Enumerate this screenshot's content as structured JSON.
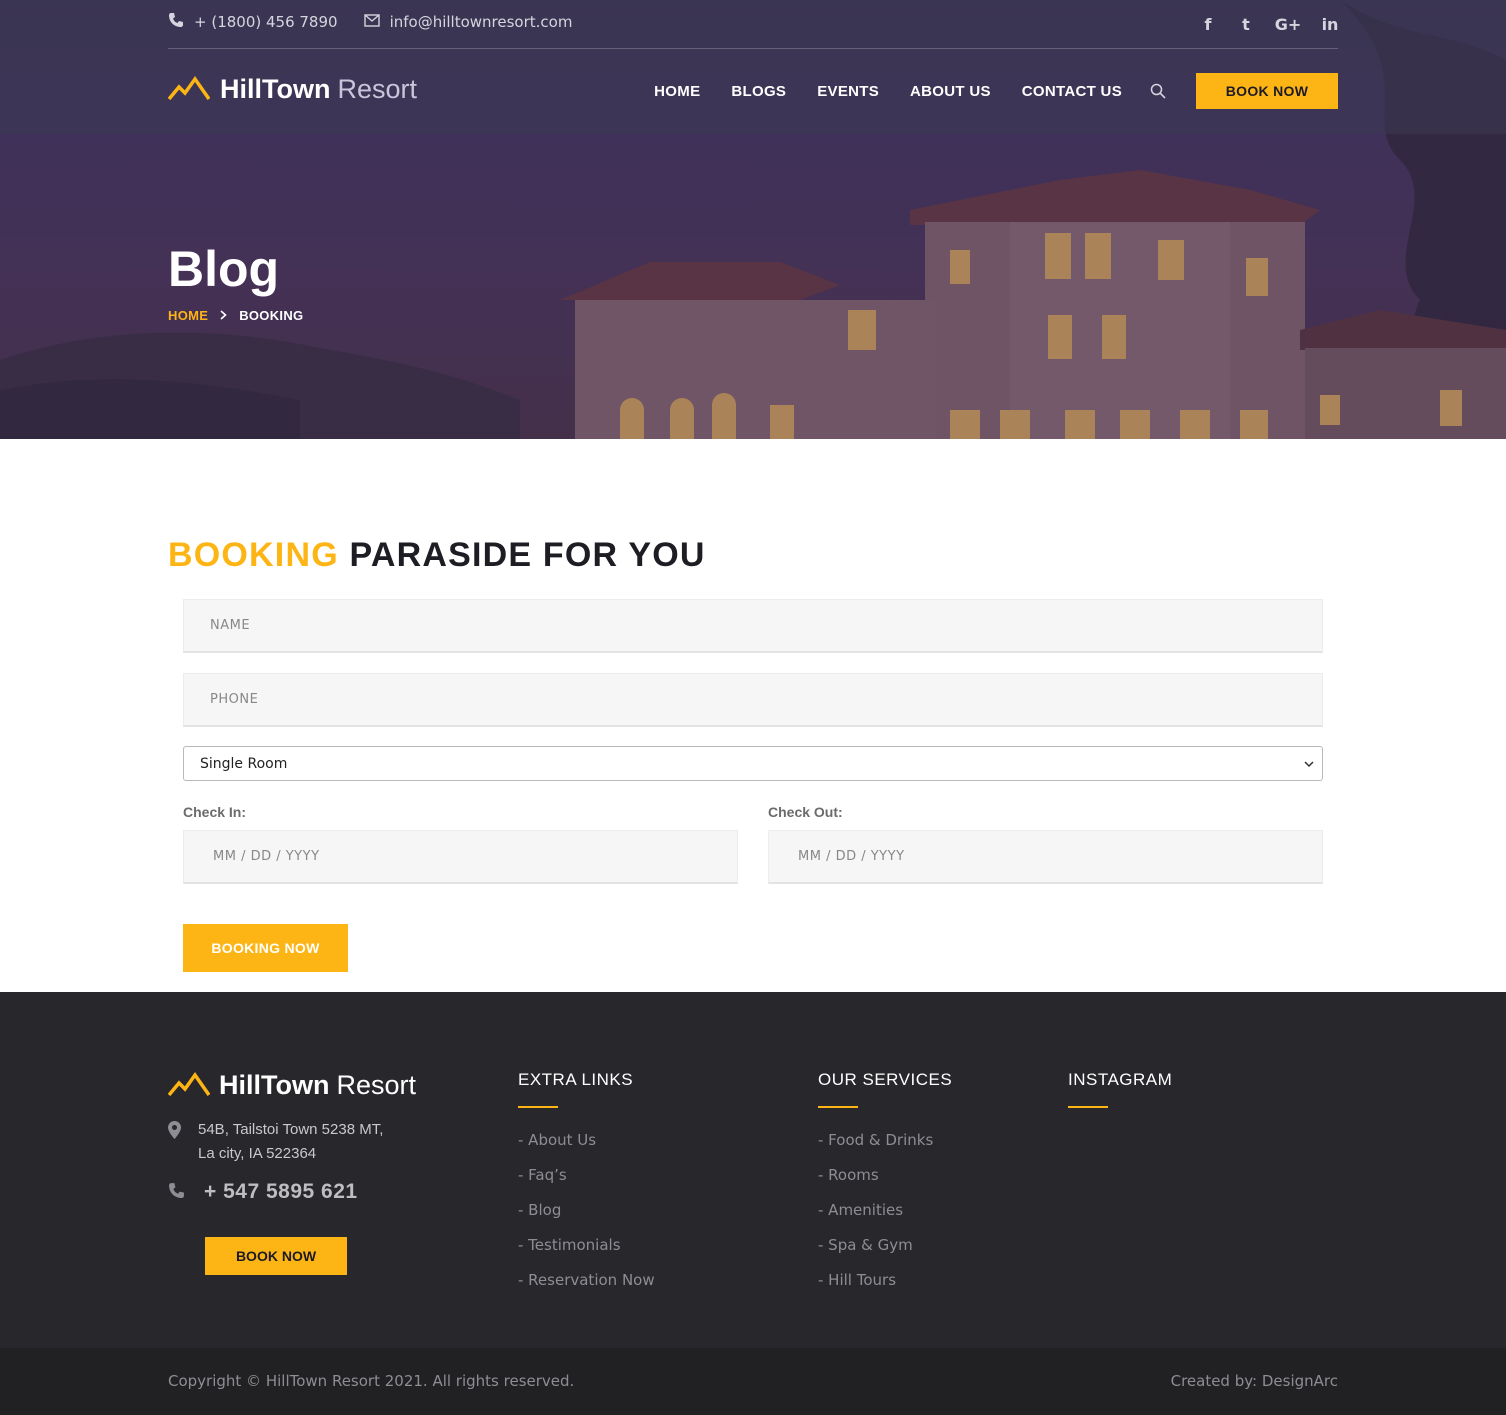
{
  "header": {
    "phone": "+ (1800) 456 7890",
    "email": "info@hilltownresort.com",
    "social": [
      "f",
      "t",
      "G+",
      "in"
    ],
    "brand_bold": "HillTown",
    "brand_light": "Resort",
    "nav": [
      "HOME",
      "BLOGS",
      "EVENTS",
      "ABOUT US",
      "CONTACT US"
    ],
    "book_now": "BOOK NOW"
  },
  "hero": {
    "title": "Blog",
    "breadcrumb_home": "HOME",
    "breadcrumb_current": "BOOKING"
  },
  "booking": {
    "title_accent": "BOOKING",
    "title_rest": "PARASIDE FOR YOU",
    "name_placeholder": "NAME",
    "phone_placeholder": "PHONE",
    "room_selected": "Single Room",
    "checkin_label": "Check In:",
    "checkout_label": "Check Out:",
    "date_placeholder": "MM / DD / YYYY",
    "submit_label": "BOOKING NOW"
  },
  "footer": {
    "brand_bold": "HillTown",
    "brand_light": "Resort",
    "address_line1": "54B, Tailstoi Town 5238 MT,",
    "address_line2": "La city, IA 522364",
    "phone": "+ 547 5895 621",
    "book_now": "BOOK NOW",
    "extra_links_title": "EXTRA LINKS",
    "extra_links": [
      "- About Us",
      "- Faq’s",
      "- Blog",
      "- Testimonials",
      "- Reservation Now"
    ],
    "services_title": "OUR SERVICES",
    "services": [
      "- Food & Drinks",
      "- Rooms",
      "- Amenities",
      "- Spa & Gym",
      "- Hill Tours"
    ],
    "instagram_title": "INSTAGRAM",
    "copyright": "Copyright © HillTown Resort 2021. All rights reserved.",
    "credit": "Created by: DesignArc"
  },
  "colors": {
    "accent": "#fdb515",
    "footer_bg": "#28272b"
  }
}
